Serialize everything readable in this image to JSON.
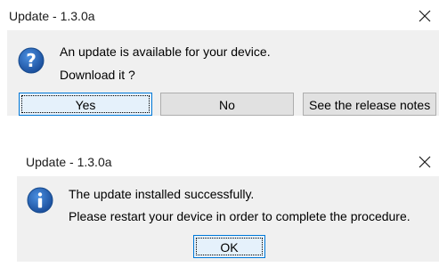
{
  "dialogs": [
    {
      "title": "Update - 1.3.0a",
      "icon": "question-icon",
      "message_line1": "An update is available for your device.",
      "message_line2": "Download it ?",
      "buttons": {
        "yes": "Yes",
        "no": "No",
        "notes": "See the release notes"
      }
    },
    {
      "title": "Update - 1.3.0a",
      "icon": "information-icon",
      "message_line1": "The update installed successfully.",
      "message_line2": "Please restart your device in order to complete the procedure.",
      "buttons": {
        "ok": "OK"
      }
    }
  ],
  "colors": {
    "icon_blue": "#1f63b8",
    "focus_border": "#0078d7",
    "content_bg": "#f0f0f0"
  }
}
